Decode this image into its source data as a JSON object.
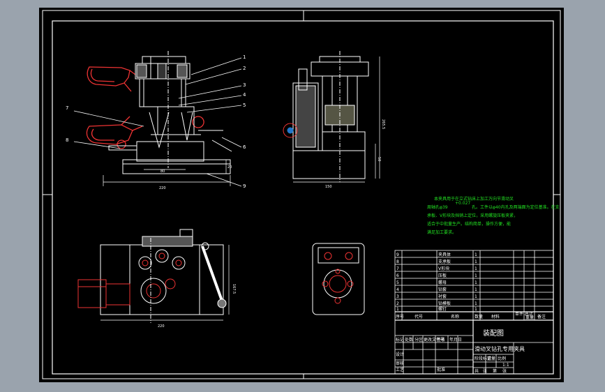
{
  "drawing": {
    "callouts": [
      "1",
      "2",
      "3",
      "4",
      "5",
      "6",
      "7",
      "8",
      "9"
    ],
    "dims": {
      "front_width": "220",
      "front_inner": "80",
      "front_step": "20",
      "side_width": "150",
      "side_height": "265.5",
      "side_base": "50",
      "plan_width": "220",
      "plan_height": "167.5"
    },
    "note": [
      "本夹具用于在立式钻床上加工万向节滑动叉",
      "周轴孔φ39",
      "孔。工件以φ40内孔及两端面为定位基准。在支",
      "承板、V形块及挡销上定位，采用螺旋压板夹紧，",
      "适合于中批量生产。结构简单，操作方便，能",
      "满足加工要求。"
    ],
    "note_superscript": "+0.027",
    "title_block": {
      "parts_rows": [
        {
          "no": "9",
          "name": "夹具体",
          "qty": "1"
        },
        {
          "no": "8",
          "name": "支承板",
          "qty": "1"
        },
        {
          "no": "7",
          "name": "V形块",
          "qty": "1"
        },
        {
          "no": "6",
          "name": "压板",
          "qty": "1"
        },
        {
          "no": "5",
          "name": "螺母",
          "qty": "1"
        },
        {
          "no": "4",
          "name": "钻套",
          "qty": "1"
        },
        {
          "no": "3",
          "name": "衬套",
          "qty": "1"
        },
        {
          "no": "2",
          "name": "钻模板",
          "qty": "1"
        },
        {
          "no": "1",
          "name": "螺钉",
          "qty": "1"
        }
      ],
      "header": {
        "seq": "序号",
        "code": "代号",
        "name": "名称",
        "qty": "数量",
        "material": "材料",
        "weight": "单件 总计",
        "weight2": "重量",
        "remark": "备注"
      },
      "drawing_name": "装配图",
      "product_name": "滑动叉钻孔专用夹具",
      "sign_labels": [
        "标记",
        "处数",
        "分区",
        "更改文件号",
        "签名",
        "年月日"
      ],
      "row_labels": [
        "设计",
        "审核",
        "工艺",
        "批准"
      ],
      "stage_labels": [
        "阶段标记",
        "重量",
        "比例"
      ],
      "scale": "1:1",
      "sheet": [
        "共",
        "张",
        "第",
        "张"
      ]
    }
  }
}
